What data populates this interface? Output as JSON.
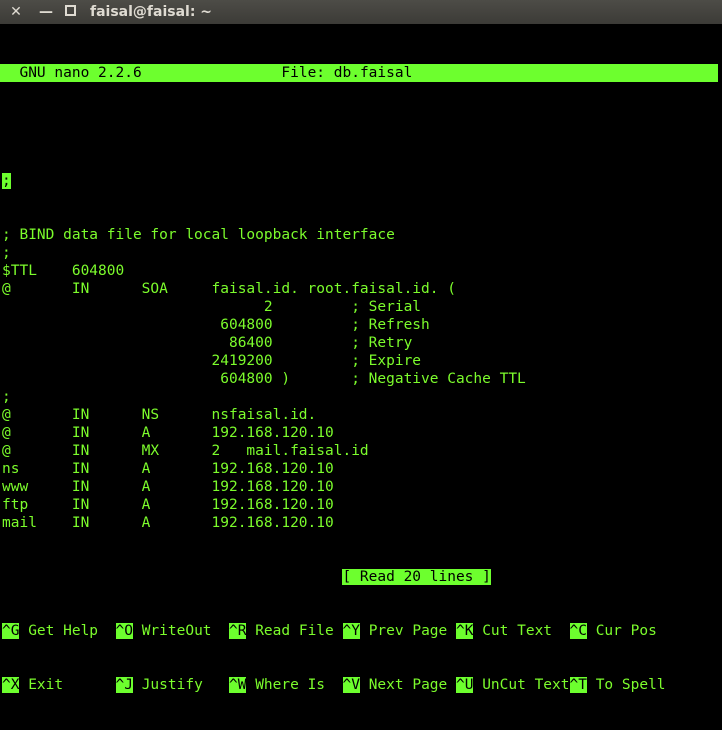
{
  "window": {
    "title": "faisal@faisal: ~",
    "close_glyph": "✕",
    "min_glyph": "—"
  },
  "nano": {
    "version": "  GNU nano 2.2.6",
    "file": "File: db.faisal"
  },
  "content": {
    "cursor_char": ";",
    "lines": [
      "",
      "; BIND data file for local loopback interface",
      ";",
      "$TTL    604800",
      "@       IN      SOA     faisal.id. root.faisal.id. (",
      "                              2         ; Serial",
      "                         604800         ; Refresh",
      "                          86400         ; Retry",
      "                        2419200         ; Expire",
      "                         604800 )       ; Negative Cache TTL",
      ";",
      "@       IN      NS      nsfaisal.id.",
      "@       IN      A       192.168.120.10",
      "@       IN      MX      2   mail.faisal.id",
      "ns      IN      A       192.168.120.10",
      "www     IN      A       192.168.120.10",
      "ftp     IN      A       192.168.120.10",
      "mail    IN      A       192.168.120.10"
    ]
  },
  "status": "[ Read 20 lines ]",
  "shortcuts_row1": [
    {
      "key": "^G",
      "label": " Get Help  "
    },
    {
      "key": "^O",
      "label": " WriteOut  "
    },
    {
      "key": "^R",
      "label": " Read File "
    },
    {
      "key": "^Y",
      "label": " Prev Page "
    },
    {
      "key": "^K",
      "label": " Cut Text  "
    },
    {
      "key": "^C",
      "label": " Cur Pos"
    }
  ],
  "shortcuts_row2": [
    {
      "key": "^X",
      "label": " Exit      "
    },
    {
      "key": "^J",
      "label": " Justify   "
    },
    {
      "key": "^W",
      "label": " Where Is  "
    },
    {
      "key": "^V",
      "label": " Next Page "
    },
    {
      "key": "^U",
      "label": " UnCut Text"
    },
    {
      "key": "^T",
      "label": " To Spell"
    }
  ]
}
